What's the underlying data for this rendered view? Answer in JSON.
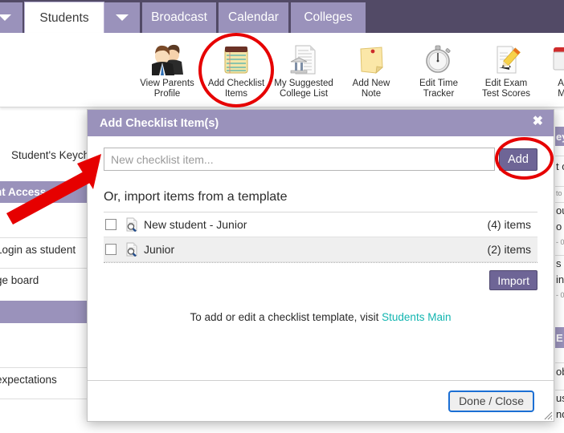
{
  "tabs": [
    {
      "label": "",
      "icon": "chevron-down-icon",
      "type": "caret"
    },
    {
      "label": "Students",
      "type": "active"
    },
    {
      "label": "",
      "icon": "chevron-down-icon",
      "type": "caret"
    },
    {
      "label": "Broadcast",
      "type": "normal"
    },
    {
      "label": "Calendar",
      "type": "normal"
    },
    {
      "label": "Colleges",
      "type": "normal"
    }
  ],
  "toolbar": {
    "items": [
      {
        "label": "View Parents\nProfile",
        "icon": "parents-profile-icon"
      },
      {
        "label": "Add Checklist\nItems",
        "icon": "checklist-notepad-icon"
      },
      {
        "label": "My Suggested\nCollege List",
        "icon": "college-list-icon"
      },
      {
        "label": "Add New\nNote",
        "icon": "sticky-note-icon"
      },
      {
        "label": "Edit Time\nTracker",
        "icon": "stopwatch-icon"
      },
      {
        "label": "Edit Exam\nTest Scores",
        "icon": "edit-pencil-document-icon"
      },
      {
        "label": "Ac\nM",
        "icon": "partial-cut-icon"
      }
    ]
  },
  "background": {
    "left_rows": [
      {
        "text": "Student's Keychain",
        "kind": "plain"
      },
      {
        "text": "nt Access",
        "kind": "header"
      },
      {
        "text": "Login as student",
        "kind": "plain"
      },
      {
        "text": "ge board",
        "kind": "plain"
      },
      {
        "text": "",
        "kind": "header"
      },
      {
        "text": "expectations",
        "kind": "plain"
      }
    ],
    "right_rows": [
      {
        "text": "ey",
        "kind": "header"
      },
      {
        "text": "t o",
        "kind": "plain"
      },
      {
        "text": "to l",
        "kind": "small"
      },
      {
        "text": "ou",
        "kind": "plain"
      },
      {
        "text": "o p",
        "kind": "plain"
      },
      {
        "text": "- 0",
        "kind": "small"
      },
      {
        "text": "s w",
        "kind": "plain"
      },
      {
        "text": "ing",
        "kind": "plain"
      },
      {
        "text": "- 0",
        "kind": "small"
      },
      {
        "text": "E",
        "kind": "header"
      },
      {
        "text": "ob",
        "kind": "plain"
      },
      {
        "text": "us",
        "kind": "plain"
      },
      {
        "text": "nd",
        "kind": "plain"
      }
    ]
  },
  "modal": {
    "title": "Add Checklist Item(s)",
    "close_label": "✖",
    "input_placeholder": "New checklist item...",
    "input_value": "",
    "add_label": "Add",
    "section_title": "Or, import items from a template",
    "templates": [
      {
        "name": "New student - Junior",
        "count": "(4) items",
        "checked": false
      },
      {
        "name": "Junior",
        "count": "(2) items",
        "checked": false
      }
    ],
    "import_label": "Import",
    "hint_prefix": "To add or edit a checklist template, visit ",
    "hint_link": "Students Main",
    "done_label": "Done / Close"
  },
  "colors": {
    "tabbar_dark": "#524a66",
    "brand_purple": "#9a92bb",
    "button_purple": "#6e6596",
    "link_teal": "#12b5b0",
    "annotation_red": "#e60000",
    "focus_blue": "#1b6fd4"
  }
}
